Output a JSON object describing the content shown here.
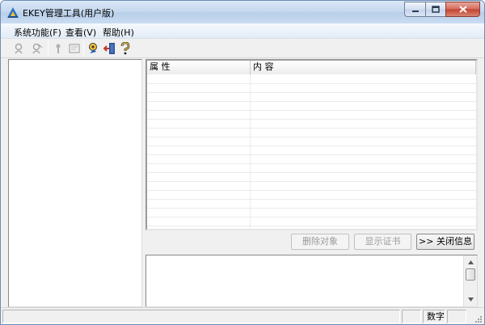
{
  "window": {
    "title": "EKEY管理工具(用户版)"
  },
  "menu": {
    "items": [
      {
        "label": "系统功能(F)"
      },
      {
        "label": "查看(V)"
      },
      {
        "label": "帮助(H)"
      }
    ]
  },
  "toolbar": {
    "buttons": [
      {
        "icon": "key-user-icon",
        "enabled": false
      },
      {
        "icon": "key-user-remove-icon",
        "enabled": false
      },
      {
        "icon": "pin-icon",
        "enabled": false
      },
      {
        "icon": "certificate-icon",
        "enabled": false
      },
      {
        "icon": "refresh-key-icon",
        "enabled": true
      },
      {
        "icon": "exit-door-icon",
        "enabled": true
      },
      {
        "icon": "help-question-icon",
        "enabled": true
      }
    ]
  },
  "list": {
    "columns": [
      {
        "label": "属 性"
      },
      {
        "label": "内 容"
      }
    ],
    "rows": []
  },
  "actions": {
    "delete_label": "删除对象",
    "show_cert_label": "显示证书",
    "close_info_label": ">> 关闭信息"
  },
  "status": {
    "panes": [
      "",
      "",
      "数字",
      ""
    ]
  },
  "colors": {
    "titlebar": "#c6d9ef",
    "close_button": "#c3412e",
    "window_bg": "#f0f0f0"
  }
}
